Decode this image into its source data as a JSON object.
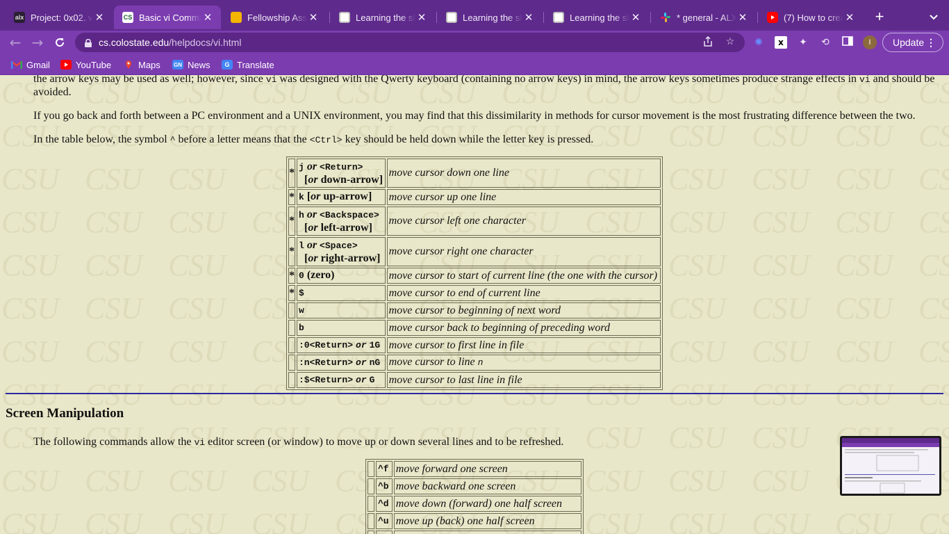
{
  "browser": {
    "tabs": [
      {
        "title": "Project: 0x02. vi",
        "favicon": "alx-icon",
        "favicon_text": "alx",
        "active": false
      },
      {
        "title": "Basic vi Comma",
        "favicon": "colostate-icon",
        "favicon_text": "CS",
        "active": true
      },
      {
        "title": "Fellowship Asse",
        "favicon": "slides-icon",
        "favicon_text": "",
        "active": false
      },
      {
        "title": "Learning the sh",
        "favicon": "doc-page-icon",
        "favicon_text": "",
        "active": false
      },
      {
        "title": "Learning the sh",
        "favicon": "doc-page-icon",
        "favicon_text": "",
        "active": false
      },
      {
        "title": "Learning the sh",
        "favicon": "doc-page-icon",
        "favicon_text": "",
        "active": false
      },
      {
        "title": "* general - ALX",
        "favicon": "slack-icon",
        "favicon_text": "",
        "active": false
      },
      {
        "title": "(7) How to creat",
        "favicon": "youtube-icon",
        "favicon_text": "",
        "active": false
      }
    ],
    "new_tab_label": "+",
    "url_host": "cs.colostate.edu",
    "url_path": "/helpdocs/vi.html",
    "avatar_letter": "I",
    "update_label": "Update",
    "bookmarks": [
      {
        "label": "Gmail",
        "icon": "gmail-icon"
      },
      {
        "label": "YouTube",
        "icon": "youtube-icon"
      },
      {
        "label": "Maps",
        "icon": "maps-icon"
      },
      {
        "label": "News",
        "icon": "news-icon"
      },
      {
        "label": "Translate",
        "icon": "translate-icon"
      }
    ],
    "colors": {
      "tabbar": "#5e2a8c",
      "toolbar": "#7b3cb0",
      "page_bg": "#e9e7c9",
      "rule": "#2a2a9c"
    }
  },
  "page": {
    "intro_partial_a": "the arrow keys may be used as well; however, since ",
    "intro_vi_1": "vi",
    "intro_partial_b": " was designed with the Qwerty keyboard (containing no arrow keys) in mind, the arrow keys sometimes produce strange effects in ",
    "intro_vi_2": "vi",
    "intro_partial_c": " and should be",
    "intro_partial_d": "avoided.",
    "para_pc_unix": "If you go back and forth between a PC environment and a UNIX environment, you may find that this dissimilarity in methods for cursor movement is the most frustrating difference between the two.",
    "para_table_a": "In the table below, the symbol ",
    "para_table_caret": "^",
    "para_table_b": " before a letter means that the ",
    "para_table_ctrl": "<Ctrl>",
    "para_table_c": " key should be held down while the letter key is pressed.",
    "cursor_table": [
      {
        "star": "*",
        "cmd": "j",
        "or": "or",
        "alt": "<Return>",
        "extra": "down-arrow",
        "desc": "move cursor down one line"
      },
      {
        "star": "*",
        "cmd": "k",
        "or": "or",
        "alt": "",
        "extra_inline": "up-arrow",
        "desc": "move cursor up one line"
      },
      {
        "star": "*",
        "cmd": "h",
        "or": "or",
        "alt": "<Backspace>",
        "extra": "left-arrow",
        "desc": "move cursor left one character"
      },
      {
        "star": "*",
        "cmd": "l",
        "or": "or",
        "alt": "<Space>",
        "extra": "right-arrow",
        "desc": "move cursor right one character"
      },
      {
        "star": "*",
        "cmd": "0",
        "note": "(zero)",
        "desc": "move cursor to start of current line (the one with the cursor)"
      },
      {
        "star": "*",
        "cmd": "$",
        "desc": "move cursor to end of current line"
      },
      {
        "star": "",
        "cmd": "w",
        "desc": "move cursor to beginning of next word"
      },
      {
        "star": "",
        "cmd": "b",
        "desc": "move cursor back to beginning of preceding word"
      },
      {
        "star": "",
        "cmd": ":0<Return>",
        "or": "or",
        "alt": "1G",
        "desc": "move cursor to first line in file"
      },
      {
        "star": "",
        "cmd": ":n<Return>",
        "or": "or",
        "alt": "nG",
        "desc": "move cursor to line",
        "desc_code": "n"
      },
      {
        "star": "",
        "cmd": ":$<Return>",
        "or": "or",
        "alt": "G",
        "desc": "move cursor to last line in file"
      }
    ],
    "or_word": "or",
    "bracket_open": "[",
    "bracket_close": "]",
    "section_title": "Screen Manipulation",
    "screen_para_a": "The following commands allow the ",
    "screen_para_vi": "vi",
    "screen_para_b": " editor screen (or window) to move up or down several lines and to be refreshed.",
    "screen_table": [
      {
        "cmd": "^f",
        "desc": "move forward one screen"
      },
      {
        "cmd": "^b",
        "desc": "move backward one screen"
      },
      {
        "cmd": "^d",
        "desc": "move down (forward) one half screen"
      },
      {
        "cmd": "^u",
        "desc": "move up (back) one half screen"
      }
    ]
  }
}
